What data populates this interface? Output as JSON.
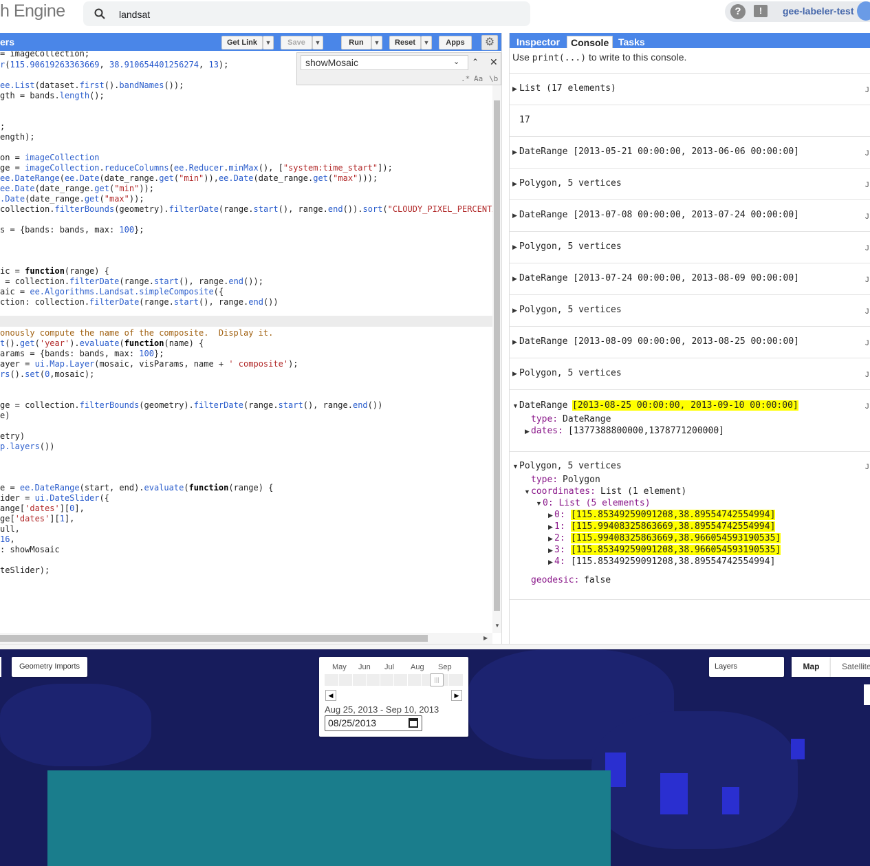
{
  "app": {
    "logo_text": "h Engine"
  },
  "search": {
    "value": "landsat"
  },
  "user": {
    "name": "gee-labeler-test"
  },
  "editor": {
    "title": "ers",
    "buttons": {
      "get_link": "Get Link",
      "save": "Save",
      "run": "Run",
      "reset": "Reset",
      "apps": "Apps"
    },
    "find": {
      "value": "showMosaic",
      "opt_regex": ".*",
      "opt_case": "Aa",
      "opt_word": "\\b"
    }
  },
  "panel": {
    "tabs": {
      "inspector": "Inspector",
      "console": "Console",
      "tasks": "Tasks"
    },
    "hint_prefix": "Use ",
    "hint_code": "print(...)",
    "hint_suffix": " to write to this console."
  },
  "console": {
    "rows": [
      "List (17 elements)",
      "17",
      "DateRange [2013-05-21 00:00:00, 2013-06-06 00:00:00]",
      "Polygon, 5 vertices",
      "DateRange [2013-07-08 00:00:00, 2013-07-24 00:00:00]",
      "Polygon, 5 vertices",
      "DateRange [2013-07-24 00:00:00, 2013-08-09 00:00:00]",
      "Polygon, 5 vertices",
      "DateRange [2013-08-09 00:00:00, 2013-08-25 00:00:00]",
      "Polygon, 5 vertices"
    ],
    "json_label": "J",
    "expanded_daterange": {
      "label": "DateRange",
      "value": "[2013-08-25 00:00:00, 2013-09-10 00:00:00]",
      "type_key": "type:",
      "type_val": "DateRange",
      "dates_key": "dates:",
      "dates_val": "[1377388800000,1378771200000]"
    },
    "expanded_polygon": {
      "label": "Polygon, 5 vertices",
      "type_key": "type:",
      "type_val": "Polygon",
      "coords_key": "coordinates:",
      "coords_val": "List (1 element)",
      "list_label": "0: List (5 elements)",
      "points": [
        {
          "idx": "0:",
          "val": "[115.85349259091208,38.89554742554994]"
        },
        {
          "idx": "1:",
          "val": "[115.99408325863669,38.89554742554994]"
        },
        {
          "idx": "2:",
          "val": "[115.99408325863669,38.966054593190535]"
        },
        {
          "idx": "3:",
          "val": "[115.85349259091208,38.966054593190535]"
        },
        {
          "idx": "4:",
          "val": "[115.85349259091208,38.89554742554994]"
        }
      ],
      "geodesic_key": "geodesic:",
      "geodesic_val": "false"
    }
  },
  "map": {
    "geometry_imports": "Geometry Imports",
    "layers": "Layers",
    "map_btn": "Map",
    "satellite_btn": "Satellite",
    "slider": {
      "months": [
        "May",
        "Jun",
        "Jul",
        "Aug",
        "Sep"
      ],
      "range_text": "Aug 25, 2013 - Sep 10, 2013",
      "date_value": "08/25/2013"
    }
  },
  "colors": {
    "accent": "#4a86e8",
    "highlight": "#ffff00",
    "map_bg": "#171c5c"
  }
}
